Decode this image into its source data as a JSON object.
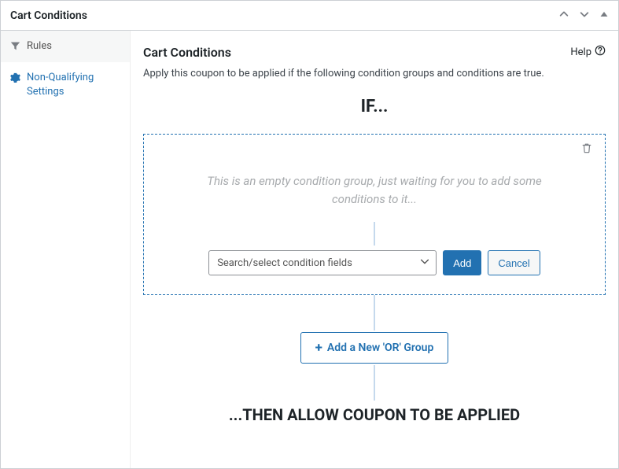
{
  "panel": {
    "title": "Cart Conditions"
  },
  "sidebar": {
    "items": [
      {
        "label": "Rules"
      },
      {
        "label": "Non-Qualifying Settings"
      }
    ]
  },
  "main": {
    "title": "Cart Conditions",
    "help_label": "Help",
    "desc": "Apply this coupon to be applied if the following condition groups and conditions are true.",
    "if_heading": "IF...",
    "then_heading": "...THEN ALLOW COUPON TO BE APPLIED",
    "add_group_label": "Add a New 'OR' Group"
  },
  "group": {
    "empty_msg": "This is an empty condition group, just waiting for you to add some conditions to it...",
    "select_placeholder": "Search/select condition fields",
    "add_label": "Add",
    "cancel_label": "Cancel"
  }
}
